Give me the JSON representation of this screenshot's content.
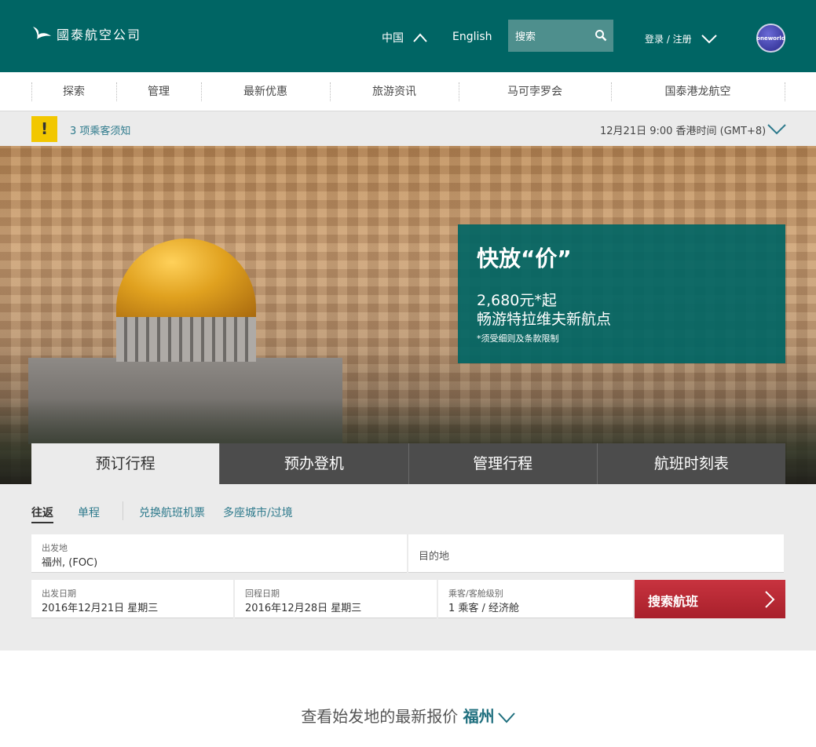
{
  "header": {
    "brand": "國泰航空公司",
    "region": "中国",
    "language": "English",
    "search_label": "搜索",
    "login": "登录 / 注册",
    "alliance": "oneworld"
  },
  "nav": {
    "items": [
      "探索",
      "管理",
      "最新优惠",
      "旅游资讯",
      "马可孛罗会",
      "国泰港龙航空"
    ]
  },
  "notice": {
    "link": "3 项乘客须知",
    "warn_symbol": "!",
    "time": "12月21日 9:00 香港时间 (GMT+8)"
  },
  "promo": {
    "title": "快放“价”",
    "price": "2,680元*起",
    "subtitle": "畅游特拉维夫新航点",
    "note": "*须受细则及条款限制"
  },
  "tabs": [
    {
      "label": "预订行程",
      "active": true
    },
    {
      "label": "预办登机",
      "active": false
    },
    {
      "label": "管理行程",
      "active": false
    },
    {
      "label": "航班时刻表",
      "active": false
    }
  ],
  "booking": {
    "trip_types": {
      "round": "往返",
      "oneway": "单程",
      "redeem": "兑换航班机票",
      "multi": "多座城市/过境"
    },
    "origin_label": "出发地",
    "origin_value": "福州, (FOC)",
    "destination_placeholder": "目的地",
    "depart_label": "出发日期",
    "depart_value": "2016年12月21日 星期三",
    "return_label": "回程日期",
    "return_value": "2016年12月28日 星期三",
    "pax_label": "乘客/客舱级别",
    "pax_value": "1 乘客 / 经济舱",
    "search_button": "搜索航班"
  },
  "bottom": {
    "text": "查看始发地的最新报价 ",
    "city": "福州"
  },
  "colors": {
    "brand_teal": "#006564",
    "search_red": "#b7262f",
    "warning_yellow": "#f2c700",
    "link_teal": "#2e7a8c"
  }
}
